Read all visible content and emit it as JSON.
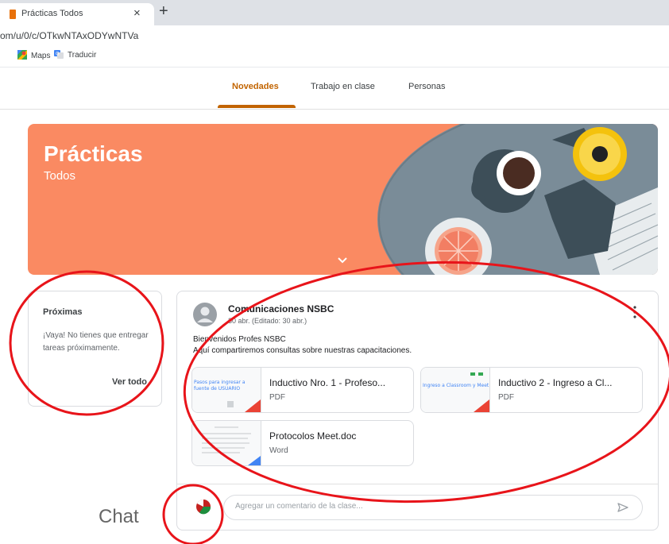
{
  "browser": {
    "tab_title": "Prácticas Todos",
    "tab_close": "×",
    "new_tab": "+",
    "url": "om/u/0/c/OTkwNTAxODYwNTVa",
    "bookmarks": [
      "Maps",
      "Traducir"
    ]
  },
  "nav": {
    "tabs": [
      "Novedades",
      "Trabajo en clase",
      "Personas"
    ],
    "active": "Novedades"
  },
  "banner": {
    "title": "Prácticas",
    "subtitle": "Todos",
    "color": "#fa8a62"
  },
  "upcoming": {
    "title": "Próximas",
    "message": "¡Vaya! No tienes que entregar tareas próximamente.",
    "link": "Ver todo"
  },
  "post": {
    "author": "Comunicaciones NSBC",
    "date": "30 abr. (Editado: 30 abr.)",
    "line1": "Bienvenidos Profes NSBC",
    "line2": "Aquí compartiremos consultas sobre nuestras capacitaciones.",
    "attachments": [
      {
        "name": "Inductivo Nro. 1 - Profeso...",
        "type": "PDF",
        "thumb_text": "Pasos para ingresar a fuente de USUARIO"
      },
      {
        "name": "Inductivo 2 - Ingreso a Cl...",
        "type": "PDF",
        "thumb_text": "Ingreso a Classroom y Meet"
      },
      {
        "name": "Protocolos Meet.doc",
        "type": "Word",
        "thumb_text": ""
      }
    ]
  },
  "comment": {
    "placeholder": "Agregar un comentario de la clase..."
  },
  "annotation": {
    "label": "Chat",
    "color": "#e8141a"
  }
}
